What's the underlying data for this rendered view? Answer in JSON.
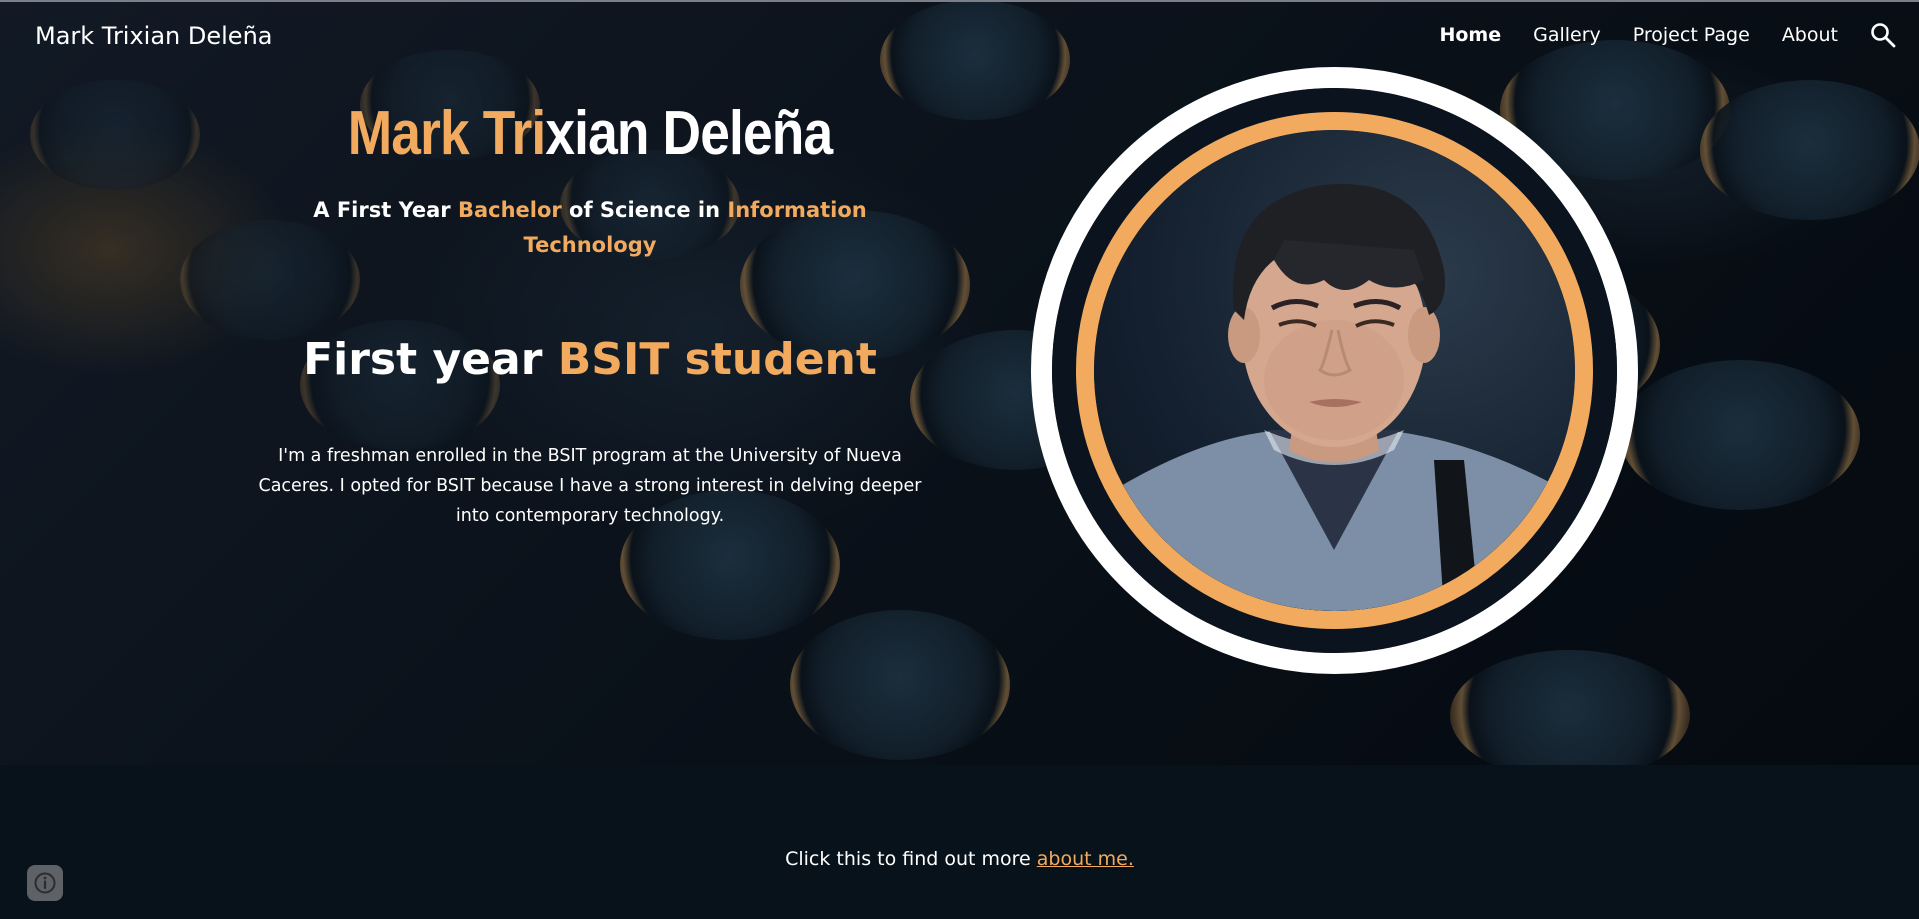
{
  "header": {
    "site_title": "Mark Trixian Deleña",
    "nav": [
      {
        "label": "Home",
        "active": true
      },
      {
        "label": "Gallery",
        "active": false
      },
      {
        "label": "Project Page",
        "active": false
      },
      {
        "label": "About",
        "active": false
      }
    ],
    "search_icon": "search-icon"
  },
  "hero": {
    "name_accent": "Mark Tri",
    "name_rest": "xian Deleña",
    "subtitle_parts": {
      "p1": "A First Year ",
      "p2": "Bachelor",
      "p3": " of Science in ",
      "p4": "Information Technology"
    },
    "heading_white": "First year ",
    "heading_accent": "BSIT student",
    "bio": "I'm a freshman enrolled in the BSIT program at the University of Nueva Caceres. I opted for BSIT because I have a strong interest in delving deeper into contemporary technology."
  },
  "portrait": {
    "alt": "profile-photo"
  },
  "footer": {
    "cta_text": "Click this to find out more ",
    "cta_link": "about me."
  },
  "colors": {
    "accent": "#f2aa5e",
    "text": "#ffffff",
    "background": "#08121a",
    "ring": "#ffffff"
  }
}
